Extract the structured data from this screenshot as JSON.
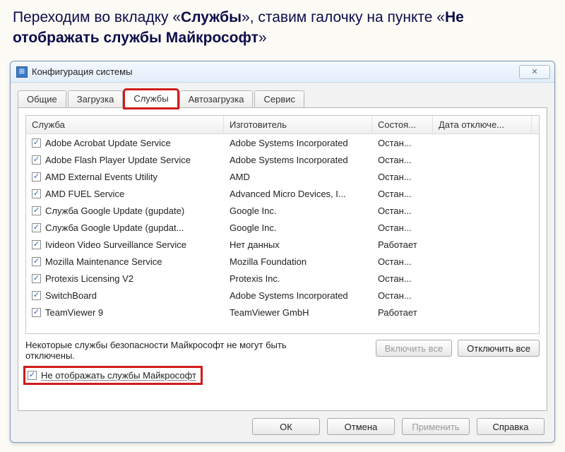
{
  "instruction": {
    "prefix1": "Переходим во вкладку «",
    "bold1": "Службы",
    "mid": "»,  ставим  галочку на пункте «",
    "bold2": "Не отображать службы Майкрософт",
    "suffix": "»"
  },
  "window": {
    "title": "Конфигурация системы",
    "close_symbol": "✕"
  },
  "tabs": [
    "Общие",
    "Загрузка",
    "Службы",
    "Автозагрузка",
    "Сервис"
  ],
  "activeTabIndex": 2,
  "columns": [
    "Служба",
    "Изготовитель",
    "Состоя...",
    "Дата отключе..."
  ],
  "rows": [
    {
      "checked": true,
      "service": "Adobe Acrobat Update Service",
      "vendor": "Adobe Systems Incorporated",
      "status": "Остан...",
      "date": ""
    },
    {
      "checked": true,
      "service": "Adobe Flash Player Update Service",
      "vendor": "Adobe Systems Incorporated",
      "status": "Остан...",
      "date": ""
    },
    {
      "checked": true,
      "service": "AMD External Events Utility",
      "vendor": "AMD",
      "status": "Остан...",
      "date": ""
    },
    {
      "checked": true,
      "service": "AMD FUEL Service",
      "vendor": "Advanced Micro Devices, I...",
      "status": "Остан...",
      "date": ""
    },
    {
      "checked": true,
      "service": "Служба Google Update (gupdate)",
      "vendor": "Google Inc.",
      "status": "Остан...",
      "date": ""
    },
    {
      "checked": true,
      "service": "Служба Google Update (gupdat...",
      "vendor": "Google Inc.",
      "status": "Остан...",
      "date": ""
    },
    {
      "checked": true,
      "service": "Ivideon Video Surveillance Service",
      "vendor": "Нет данных",
      "status": "Работает",
      "date": ""
    },
    {
      "checked": true,
      "service": "Mozilla Maintenance Service",
      "vendor": "Mozilla Foundation",
      "status": "Остан...",
      "date": ""
    },
    {
      "checked": true,
      "service": "Protexis Licensing V2",
      "vendor": "Protexis Inc.",
      "status": "Остан...",
      "date": ""
    },
    {
      "checked": true,
      "service": "SwitchBoard",
      "vendor": "Adobe Systems Incorporated",
      "status": "Остан...",
      "date": ""
    },
    {
      "checked": true,
      "service": "TeamViewer 9",
      "vendor": "TeamViewer GmbH",
      "status": "Работает",
      "date": ""
    }
  ],
  "note": "Некоторые службы безопасности Майкрософт не могут быть отключены.",
  "buttons": {
    "enable_all": "Включить все",
    "disable_all": "Отключить все",
    "hide_ms": "Не отображать службы Майкрософт",
    "ok": "ОК",
    "cancel": "Отмена",
    "apply": "Применить",
    "help": "Справка"
  },
  "hide_ms_checked": true
}
